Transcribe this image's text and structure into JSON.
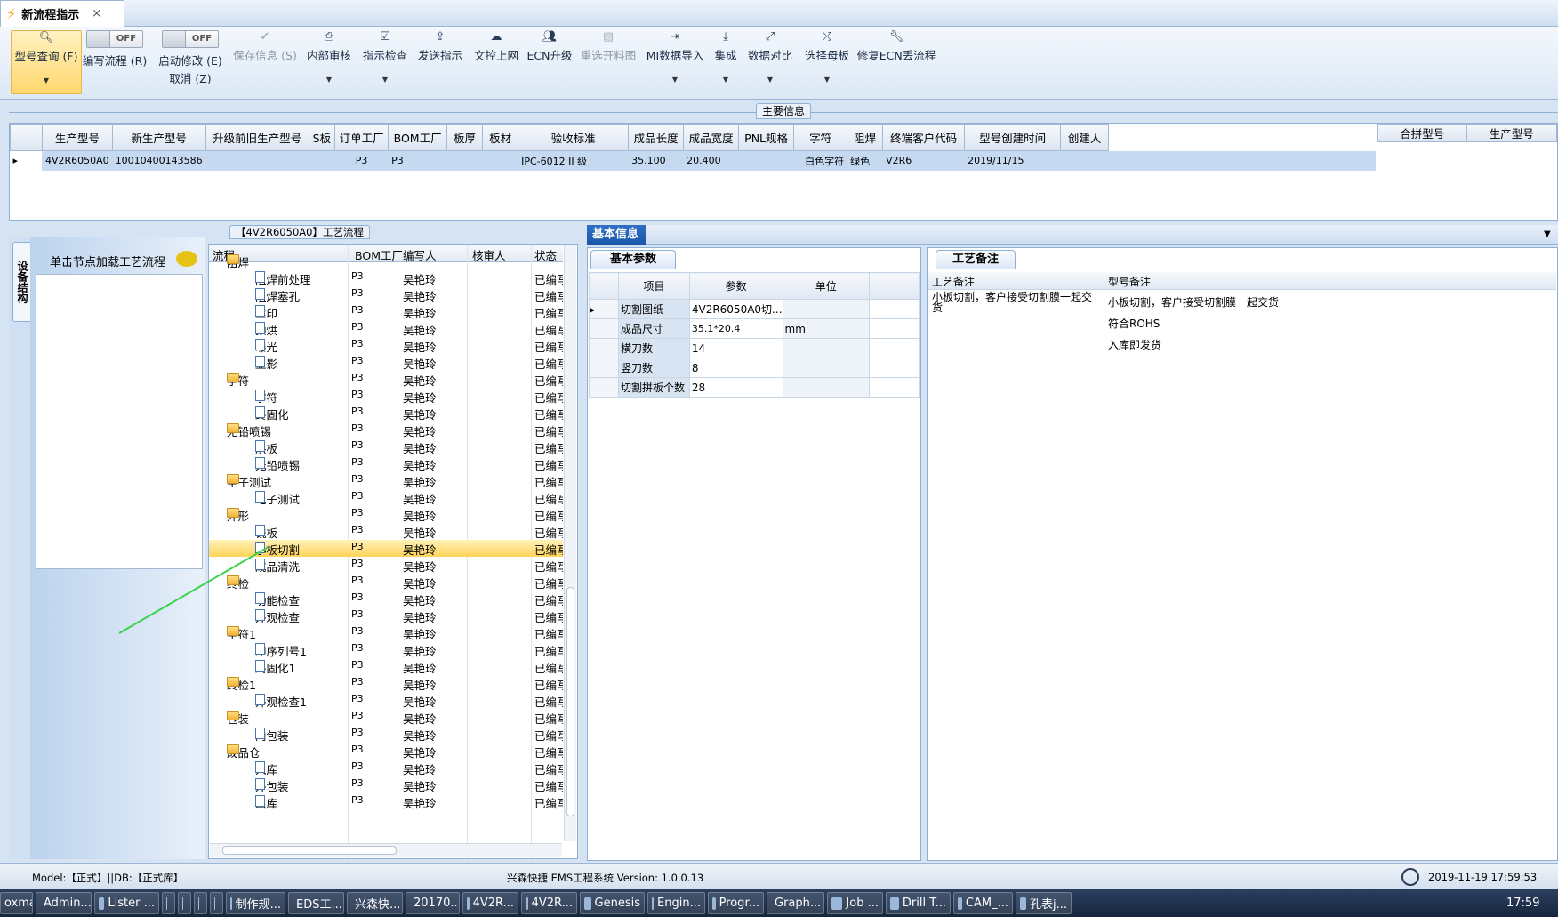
{
  "window": {
    "tab_title": "新流程指示",
    "close_glyph": "×"
  },
  "ribbon": {
    "buttons": [
      {
        "label": "型号查询 (F)",
        "icon": "search-icon"
      },
      {
        "label": "编写流程 (R)",
        "toggle": "OFF"
      },
      {
        "label": "启动修改 (E)",
        "toggle": "OFF",
        "sub": "取消 (Z)"
      },
      {
        "label": "保存信息 (S)",
        "icon": "check-icon"
      },
      {
        "label": "内部审核",
        "icon": "print-icon"
      },
      {
        "label": "指示检查",
        "icon": "checklist-icon"
      },
      {
        "label": "发送指示",
        "icon": "upload-icon"
      },
      {
        "label": "文控上网",
        "icon": "cloud-upload-icon"
      },
      {
        "label": "ECN升级",
        "icon": "users-icon"
      },
      {
        "label": "重选开料图",
        "icon": "image-icon"
      },
      {
        "label": "MI数据导入",
        "icon": "import-icon"
      },
      {
        "label": "集成",
        "icon": "download-icon"
      },
      {
        "label": "数据对比",
        "icon": "compare-icon"
      },
      {
        "label": "选择母板",
        "icon": "shuffle-icon"
      },
      {
        "label": "修复ECN丢流程",
        "icon": "wrench-icon"
      }
    ]
  },
  "main_info": {
    "title": "主要信息",
    "columns": [
      "生产型号",
      "新生产型号",
      "升级前旧生产型号",
      "S板",
      "订单工厂",
      "BOM工厂",
      "板厚",
      "板材",
      "验收标准",
      "成品长度",
      "成品宽度",
      "PNL规格",
      "字符",
      "阻焊",
      "终端客户代码",
      "型号创建时间",
      "创建人"
    ],
    "row": [
      "4V2R6050A0",
      "10010400143586",
      "",
      "",
      "P3",
      "P3",
      "",
      "",
      "IPC-6012 II 级",
      "35.100",
      "20.400",
      "",
      "白色字符",
      "绿色",
      "V2R6",
      "2019/11/15",
      ""
    ],
    "side_columns": [
      "合拼型号",
      "生产型号"
    ]
  },
  "left_panel": {
    "vtab": "设备结构",
    "load_hint": "单击节点加载工艺流程"
  },
  "tree": {
    "title": "【4V2R6050A0】工艺流程",
    "columns": [
      "流程",
      "BOM工厂",
      "编写人",
      "核审人",
      "状态"
    ],
    "rows": [
      {
        "name": "阻焊",
        "level": 0,
        "folder": true,
        "bom": "",
        "writer": "",
        "status": ""
      },
      {
        "name": "阻焊前处理",
        "level": 1,
        "bom": "P3",
        "writer": "吴艳玲",
        "status": "已编写"
      },
      {
        "name": "阻焊塞孔",
        "level": 1,
        "bom": "P3",
        "writer": "吴艳玲",
        "status": "已编写"
      },
      {
        "name": "丝印",
        "level": 1,
        "bom": "P3",
        "writer": "吴艳玲",
        "status": "已编写"
      },
      {
        "name": "预烘",
        "level": 1,
        "bom": "P3",
        "writer": "吴艳玲",
        "status": "已编写"
      },
      {
        "name": "曝光",
        "level": 1,
        "bom": "P3",
        "writer": "吴艳玲",
        "status": "已编写"
      },
      {
        "name": "显影",
        "level": 1,
        "bom": "P3",
        "writer": "吴艳玲",
        "status": "已编写"
      },
      {
        "name": "字符",
        "level": 0,
        "folder": true,
        "bom": "P3",
        "writer": "吴艳玲",
        "status": "已编写"
      },
      {
        "name": "字符",
        "level": 1,
        "bom": "P3",
        "writer": "吴艳玲",
        "status": "已编写"
      },
      {
        "name": "终固化",
        "level": 1,
        "bom": "P3",
        "writer": "吴艳玲",
        "status": "已编写"
      },
      {
        "name": "无铅喷锡",
        "level": 0,
        "folder": true,
        "bom": "P3",
        "writer": "吴艳玲",
        "status": "已编写"
      },
      {
        "name": "烘板",
        "level": 1,
        "bom": "P3",
        "writer": "吴艳玲",
        "status": "已编写"
      },
      {
        "name": "无铅喷锡",
        "level": 1,
        "bom": "P3",
        "writer": "吴艳玲",
        "status": "已编写"
      },
      {
        "name": "电子测试",
        "level": 0,
        "folder": true,
        "bom": "P3",
        "writer": "吴艳玲",
        "status": "已编写"
      },
      {
        "name": "电子测试",
        "level": 1,
        "bom": "P3",
        "writer": "吴艳玲",
        "status": "已编写"
      },
      {
        "name": "外形",
        "level": 0,
        "folder": true,
        "bom": "P3",
        "writer": "吴艳玲",
        "status": "已编写"
      },
      {
        "name": "铣板",
        "level": 1,
        "bom": "P3",
        "writer": "吴艳玲",
        "status": "已编写"
      },
      {
        "name": "小板切割",
        "level": 1,
        "bom": "P3",
        "writer": "吴艳玲",
        "status": "已编写",
        "selected": true
      },
      {
        "name": "成品清洗",
        "level": 1,
        "bom": "P3",
        "writer": "吴艳玲",
        "status": "已编写"
      },
      {
        "name": "终检",
        "level": 0,
        "folder": true,
        "bom": "P3",
        "writer": "吴艳玲",
        "status": "已编写"
      },
      {
        "name": "功能检查",
        "level": 1,
        "bom": "P3",
        "writer": "吴艳玲",
        "status": "已编写"
      },
      {
        "name": "外观检查",
        "level": 1,
        "bom": "P3",
        "writer": "吴艳玲",
        "status": "已编写"
      },
      {
        "name": "字符1",
        "level": 0,
        "folder": true,
        "bom": "P3",
        "writer": "吴艳玲",
        "status": "已编写"
      },
      {
        "name": "印序列号1",
        "level": 1,
        "bom": "P3",
        "writer": "吴艳玲",
        "status": "已编写"
      },
      {
        "name": "终固化1",
        "level": 1,
        "bom": "P3",
        "writer": "吴艳玲",
        "status": "已编写"
      },
      {
        "name": "终检1",
        "level": 0,
        "folder": true,
        "bom": "P3",
        "writer": "吴艳玲",
        "status": "已编写"
      },
      {
        "name": "外观检查1",
        "level": 1,
        "bom": "P3",
        "writer": "吴艳玲",
        "status": "已编写"
      },
      {
        "name": "包装",
        "level": 0,
        "folder": true,
        "bom": "P3",
        "writer": "吴艳玲",
        "status": "已编写"
      },
      {
        "name": "内包装",
        "level": 1,
        "bom": "P3",
        "writer": "吴艳玲",
        "status": "已编写"
      },
      {
        "name": "成品仓",
        "level": 0,
        "folder": true,
        "bom": "P3",
        "writer": "吴艳玲",
        "status": "已编写"
      },
      {
        "name": "入库",
        "level": 1,
        "bom": "P3",
        "writer": "吴艳玲",
        "status": "已编写"
      },
      {
        "name": "外包装",
        "level": 1,
        "bom": "P3",
        "writer": "吴艳玲",
        "status": "已编写"
      },
      {
        "name": "出库",
        "level": 1,
        "bom": "P3",
        "writer": "吴艳玲",
        "status": "已编写"
      }
    ]
  },
  "right": {
    "basic_tab": "基本信息",
    "params_tab": "基本参数",
    "params_columns": [
      "项目",
      "参数",
      "单位"
    ],
    "params_rows": [
      [
        "切割图纸",
        "4V2R6050A0切...",
        ""
      ],
      [
        "成品尺寸",
        "35.1*20.4",
        "mm"
      ],
      [
        "横刀数",
        "14",
        ""
      ],
      [
        "竖刀数",
        "8",
        ""
      ],
      [
        "切割拼板个数",
        "28",
        ""
      ]
    ],
    "notes_tab": "工艺备注",
    "notes_col1": "工艺备注",
    "notes_col2": "型号备注",
    "notes_text1": "小板切割，客户接受切割膜一起交货",
    "notes_text2": [
      "小板切割，客户接受切割膜一起交货",
      "符合ROHS",
      "入库即发货"
    ]
  },
  "status": {
    "left": "Model:【正式】||DB:【正式库】",
    "center": "兴森快捷 EMS工程系统 Version: 1.0.0.13",
    "datetime": "2019-11-19 17:59:53"
  },
  "taskbar": {
    "items": [
      "oxmail",
      "Admin...",
      "Lister ...",
      "",
      "",
      "",
      "",
      "制作规...",
      "EDS工...",
      "兴森快...",
      "20170...",
      "4V2R...",
      "4V2R...",
      "Genesis",
      "Engin...",
      "Progr...",
      "Graph...",
      "Job ...",
      "Drill T...",
      "CAM_...",
      "孔表j..."
    ],
    "clock": "17:59"
  },
  "colors": {
    "accent": "#1c56a8",
    "selection": "#c5d9f1",
    "tree_selection": "#ffd35a",
    "annotation_line": "#37d34a"
  }
}
